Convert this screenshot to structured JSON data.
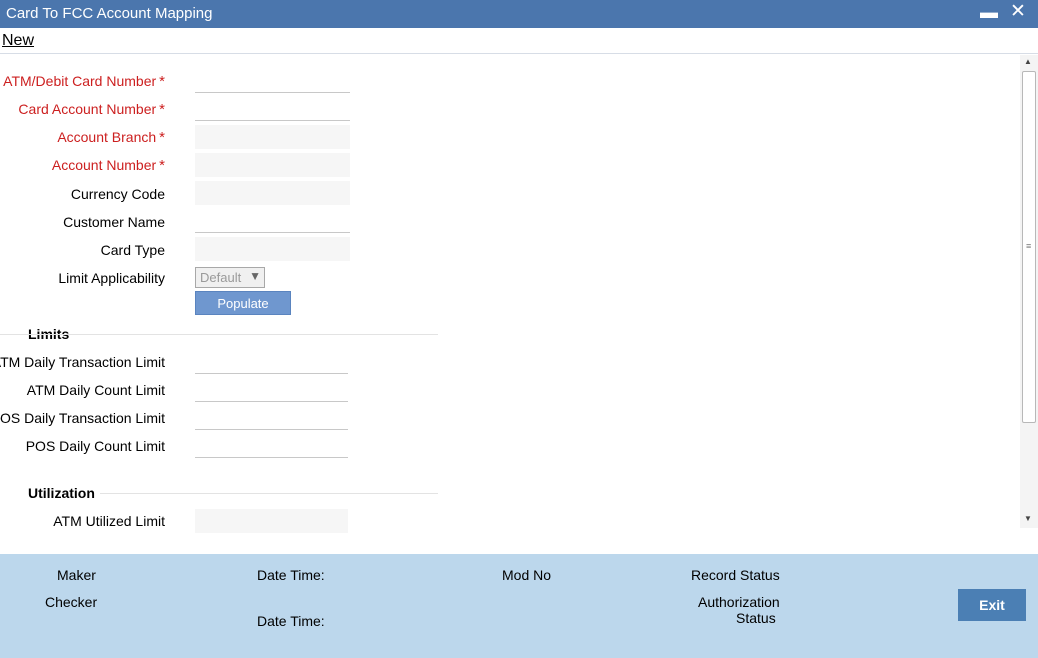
{
  "window": {
    "title": "Card To FCC Account Mapping",
    "minimize_glyph": "▬",
    "close_glyph": "✕"
  },
  "menu": {
    "new_label": "New"
  },
  "form": {
    "atm_card_number_label": "ATM/Debit Card Number",
    "card_account_number_label": "Card Account Number",
    "account_branch_label": "Account Branch",
    "account_number_label": "Account Number",
    "currency_code_label": "Currency Code",
    "customer_name_label": "Customer Name",
    "card_type_label": "Card Type",
    "limit_applicability_label": "Limit Applicability",
    "limit_applicability_value": "Default",
    "required_marker": "*",
    "populate_label": "Populate",
    "atm_card_number_value": "",
    "card_account_number_value": "",
    "account_branch_value": "",
    "account_number_value": "",
    "currency_code_value": "",
    "customer_name_value": "",
    "card_type_value": ""
  },
  "limits": {
    "heading": "Limits",
    "atm_daily_txn_label": "ATM Daily Transaction Limit",
    "atm_daily_count_label": "ATM Daily Count Limit",
    "pos_daily_txn_label": "POS Daily Transaction Limit",
    "pos_daily_count_label": "POS Daily Count Limit"
  },
  "utilization": {
    "heading": "Utilization",
    "atm_utilized_label": "ATM Utilized Limit"
  },
  "footer": {
    "maker_label": "Maker",
    "checker_label": "Checker",
    "date_time_label_1": "Date Time:",
    "date_time_label_2": "Date Time:",
    "mod_no_label": "Mod No",
    "record_status_label": "Record Status",
    "authorization_label": "Authorization",
    "status_label": "Status",
    "exit_label": "Exit"
  },
  "colors": {
    "titlebar": "#4b76ad",
    "required": "#cc1f1f",
    "footer": "#bcd7ec",
    "exit_button": "#4b7fb4",
    "populate_button": "#6f97cf"
  },
  "icons": [
    "minimize-icon",
    "close-icon",
    "dropdown-arrow-icon",
    "scroll-up-icon",
    "scroll-down-icon",
    "scroll-grip-icon"
  ]
}
